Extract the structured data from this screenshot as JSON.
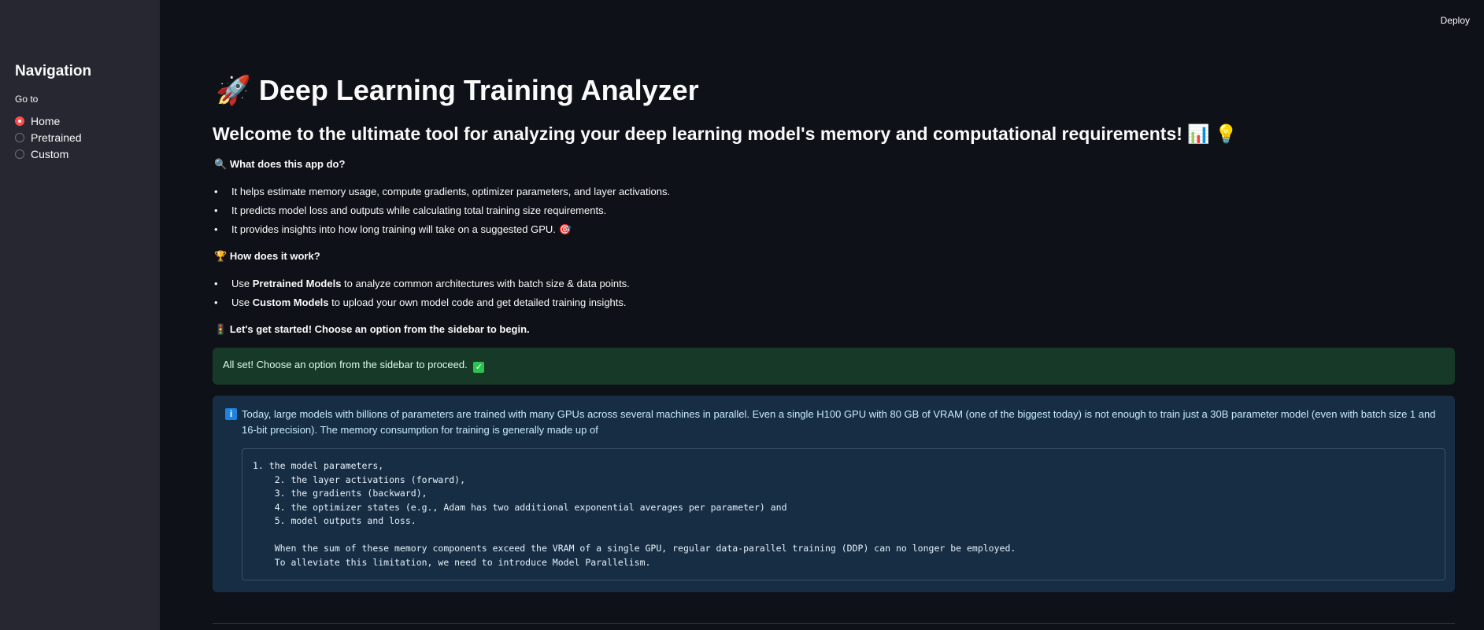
{
  "sidebar": {
    "heading": "Navigation",
    "goto_label": "Go to",
    "options": [
      {
        "label": "Home",
        "selected": true
      },
      {
        "label": "Pretrained",
        "selected": false
      },
      {
        "label": "Custom",
        "selected": false
      }
    ]
  },
  "header": {
    "deploy_label": "Deploy"
  },
  "main": {
    "title_icon": "🚀",
    "title": "Deep Learning Training Analyzer",
    "subtitle": "Welcome to the ultimate tool for analyzing your deep learning model's memory and computational requirements! 📊 💡",
    "section1": {
      "icon": "🔍",
      "heading": "What does this app do?",
      "bullets": [
        "It helps estimate memory usage, compute gradients, optimizer parameters, and layer activations.",
        "It predicts model loss and outputs while calculating total training size requirements.",
        "It provides insights into how long training will take on a suggested GPU. 🎯"
      ]
    },
    "section2": {
      "icon": "🏆",
      "heading": "How does it work?",
      "bullets": [
        {
          "pre": "Use ",
          "bold": "Pretrained Models",
          "post": " to analyze common architectures with batch size & data points."
        },
        {
          "pre": "Use ",
          "bold": "Custom Models",
          "post": " to upload your own model code and get detailed training insights."
        }
      ]
    },
    "cta": {
      "icon": "🚦",
      "text": "Let's get started! Choose an option from the sidebar to begin."
    },
    "success": {
      "text": "All set! Choose an option from the sidebar to proceed.",
      "icon": "✓"
    },
    "info": {
      "icon": "i",
      "text": "Today, large models with billions of parameters are trained with many GPUs across several machines in parallel. Even a single H100 GPU with 80 GB of VRAM (one of the biggest today) is not enough to train just a 30B parameter model (even with batch size 1 and 16-bit precision). The memory consumption for training is generally made up of",
      "code": "1. the model parameters,\n    2. the layer activations (forward),\n    3. the gradients (backward),\n    4. the optimizer states (e.g., Adam has two additional exponential averages per parameter) and\n    5. model outputs and loss.\n\n    When the sum of these memory components exceed the VRAM of a single GPU, regular data-parallel training (DDP) can no longer be employed.\n    To alleviate this limitation, we need to introduce Model Parallelism."
    }
  }
}
